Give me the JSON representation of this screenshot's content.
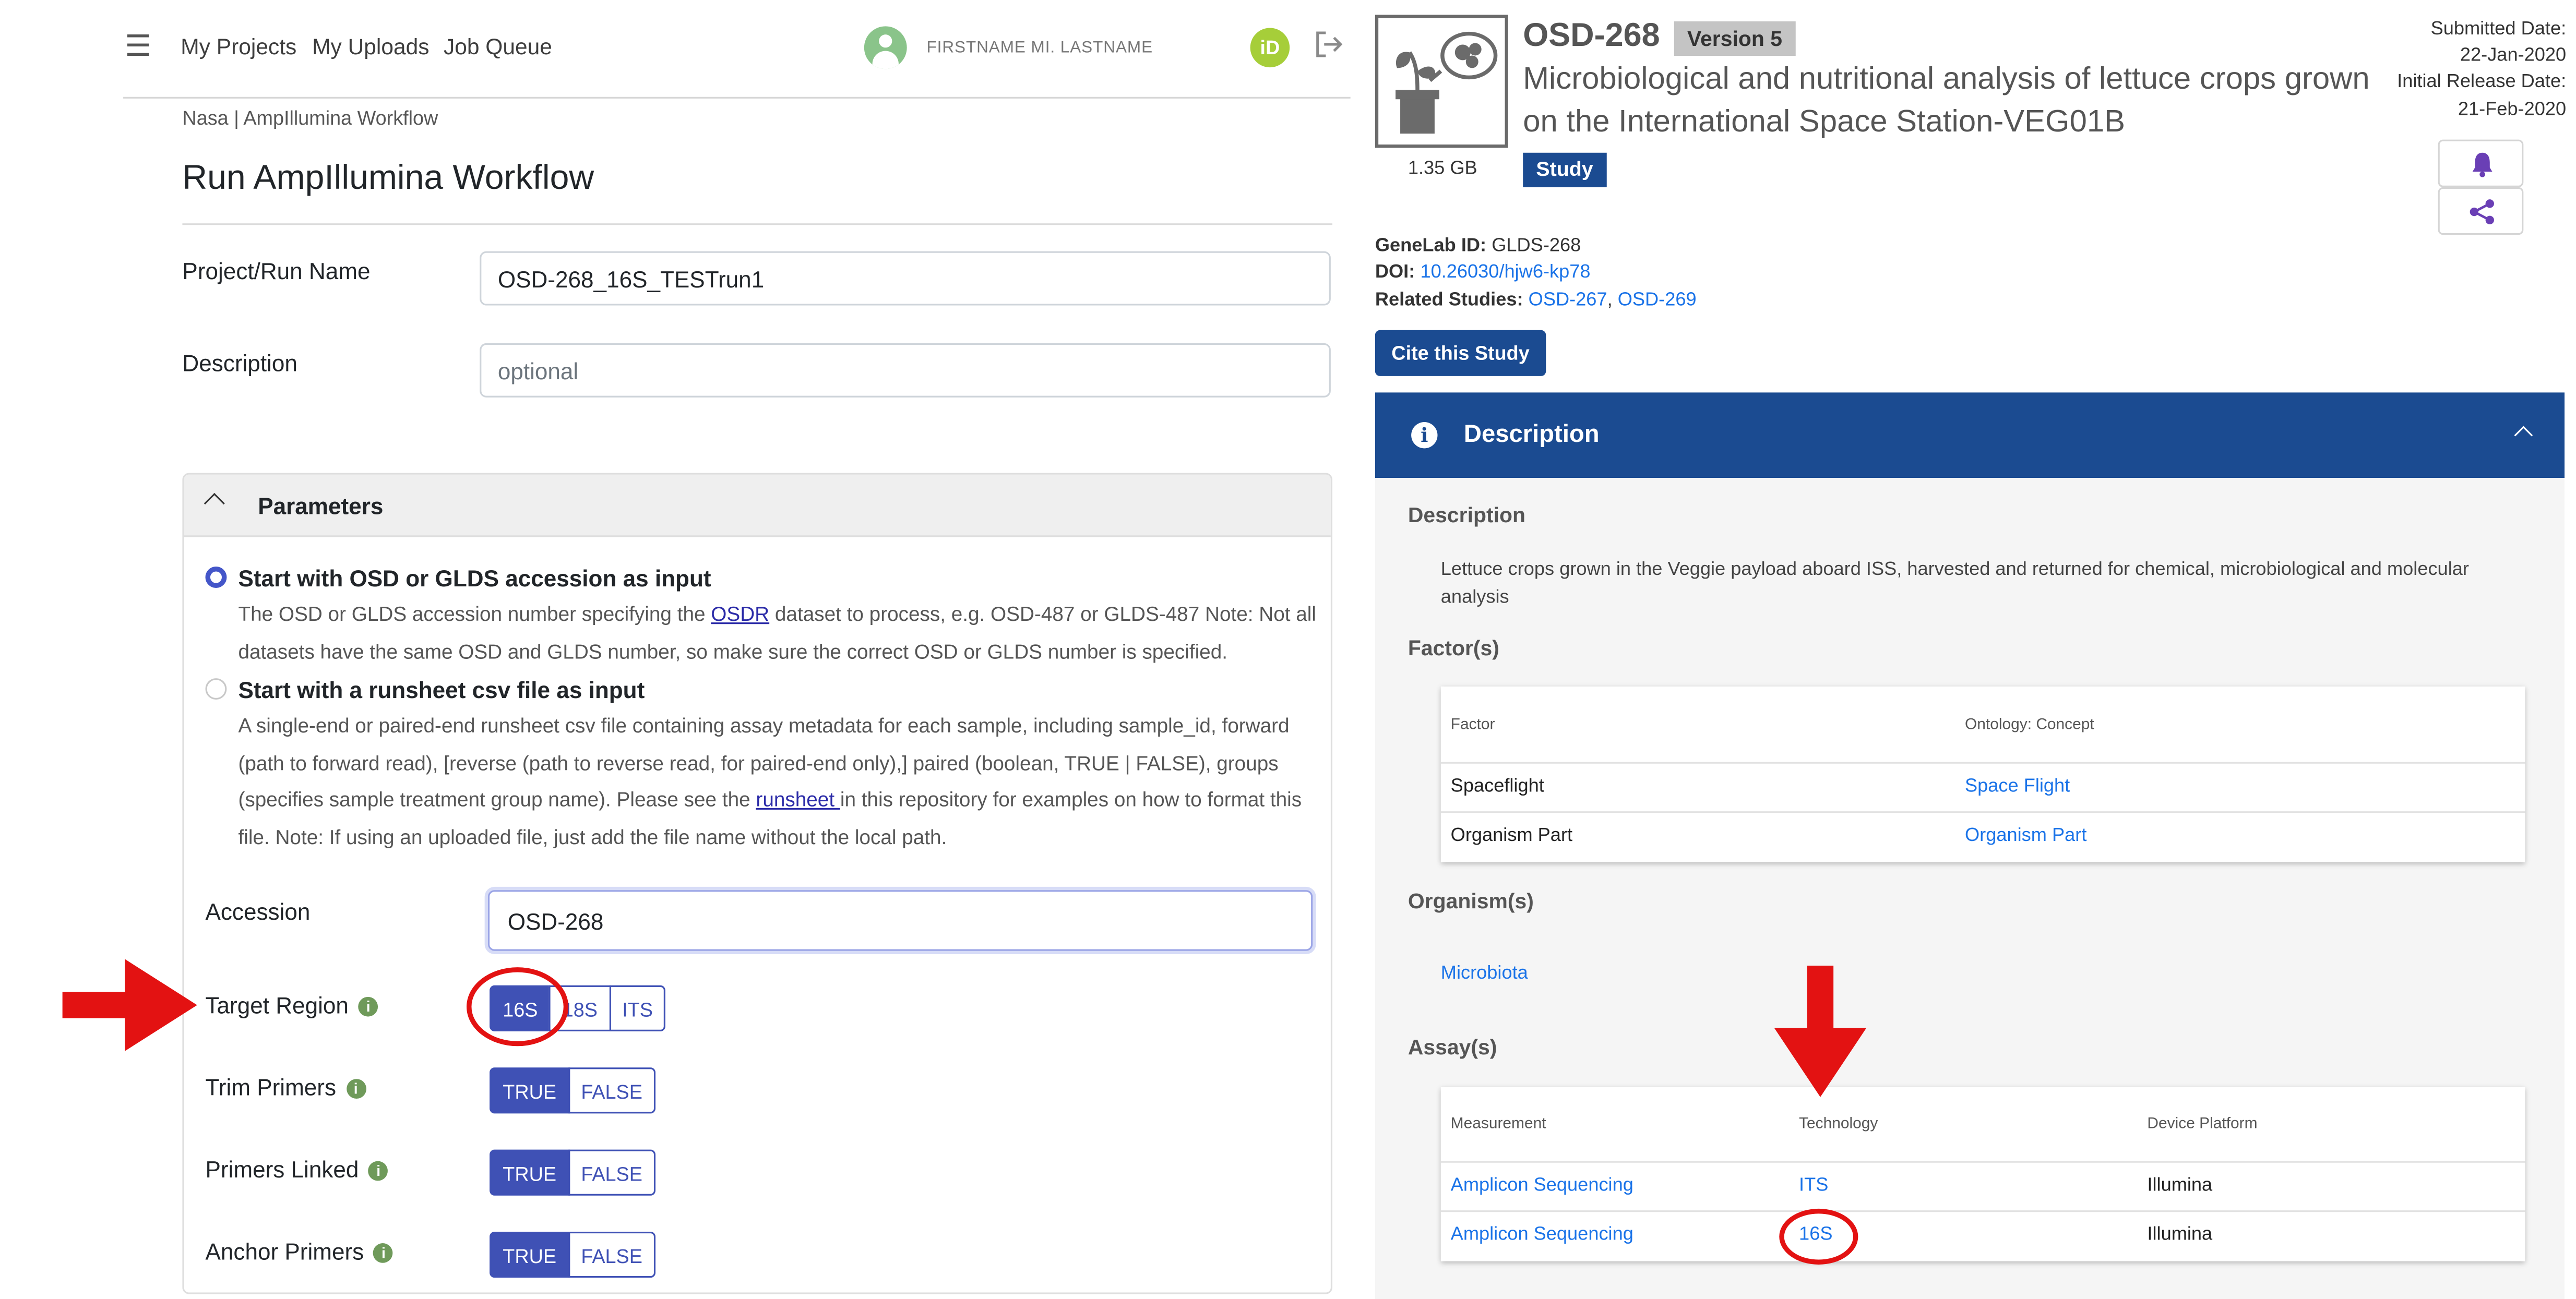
{
  "nav": {
    "menu_icon": "hamburger-icon",
    "links": [
      "My Projects",
      "My Uploads",
      "Job Queue"
    ],
    "user_name": "FIRSTNAME MI. LASTNAME",
    "orcid_label": "iD"
  },
  "breadcrumb": "Nasa | AmpIllumina Workflow",
  "page_title": "Run AmpIllumina Workflow",
  "form": {
    "project_label": "Project/Run Name",
    "project_value": "OSD-268_16S_TESTrun1",
    "description_label": "Description",
    "description_placeholder": "optional"
  },
  "parameters": {
    "title": "Parameters",
    "option1_title": "Start with OSD or GLDS accession as input",
    "option1_desc_a": "The OSD or GLDS accession number specifying the ",
    "option1_link": "OSDR",
    "option1_desc_b": " dataset to process, e.g. OSD-487 or GLDS-487 Note: Not all datasets have the same OSD and GLDS number, so make sure the correct OSD or GLDS number is specified.",
    "option2_title": "Start with a runsheet csv file as input",
    "option2_desc_a": "A single-end or paired-end runsheet csv file containing assay metadata for each sample, including sample_id, forward (path to forward read), [reverse (path to reverse read, for paired-end only),] paired (boolean, TRUE | FALSE), groups (specifies sample treatment group name). Please see the ",
    "option2_link": "runsheet ",
    "option2_desc_b": "in this repository for examples on how to format this file. Note: If using an uploaded file, just add the file name without the local path.",
    "accession_label": "Accession",
    "accession_value": "OSD-268",
    "target_region_label": "Target Region",
    "target_region_options": [
      "16S",
      "18S",
      "ITS"
    ],
    "target_region_selected": "16S",
    "trim_primers_label": "Trim Primers",
    "primers_linked_label": "Primers Linked",
    "anchor_primers_label": "Anchor Primers",
    "bool_options": [
      "TRUE",
      "FALSE"
    ],
    "bool_selected": "TRUE"
  },
  "study": {
    "size": "1.35 GB",
    "id": "OSD-268",
    "version": "Version 5",
    "title": "Microbiological and nutritional analysis of lettuce crops grown on the International Space Station-VEG01B",
    "type_badge": "Study",
    "submitted_label": "Submitted Date:",
    "submitted_date": "22-Jan-2020",
    "release_label": "Initial Release Date:",
    "release_date": "21-Feb-2020",
    "genelab_label": "GeneLab ID",
    "genelab_id": "GLDS-268",
    "doi_label": "DOI",
    "doi": "10.26030/hjw6-kp78",
    "related_label": "Related Studies",
    "related": [
      "OSD-267",
      "OSD-269"
    ],
    "cite_button": "Cite this Study",
    "bell_icon": "bell-icon",
    "share_icon": "share-icon"
  },
  "description_section": {
    "header": "Description",
    "subheading": "Description",
    "text": "Lettuce crops grown in the Veggie payload aboard ISS, harvested and returned for chemical, microbiological and molecular analysis",
    "factors_heading": "Factor(s)",
    "factor_columns": [
      "Factor",
      "Ontology: Concept"
    ],
    "factors": [
      {
        "factor": "Spaceflight",
        "concept": "Space Flight"
      },
      {
        "factor": "Organism Part",
        "concept": "Organism Part"
      }
    ],
    "organisms_heading": "Organism(s)",
    "organism": "Microbiota",
    "assays_heading": "Assay(s)",
    "assay_columns": [
      "Measurement",
      "Technology",
      "Device Platform"
    ],
    "assays": [
      {
        "measurement": "Amplicon Sequencing",
        "technology": "ITS",
        "platform": "Illumina"
      },
      {
        "measurement": "Amplicon Sequencing",
        "technology": "16S",
        "platform": "Illumina"
      }
    ]
  },
  "colors": {
    "accent": "#3f51b5",
    "brand_blue": "#1b4b91",
    "annotation_red": "#e31212",
    "link": "#1a73e8"
  }
}
